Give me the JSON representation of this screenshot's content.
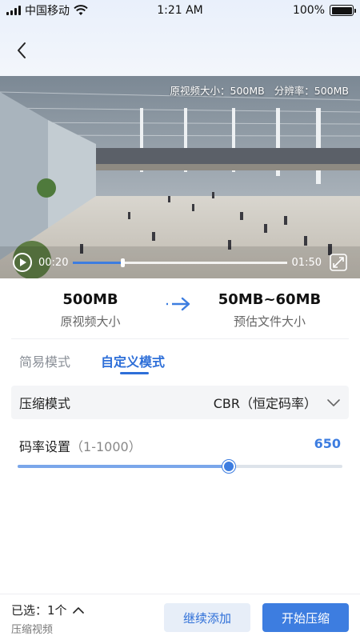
{
  "status_bar": {
    "carrier": "中国移动",
    "time": "1:21 AM",
    "battery": "100%"
  },
  "nav": {
    "back_icon": "chevron-left-icon"
  },
  "video": {
    "original_size_label": "原视频大小：500MB",
    "resolution_label": "分辨率：500MB",
    "current_time": "00:20",
    "duration": "01:50",
    "progress_fraction": 0.23
  },
  "size_compare": {
    "original_value": "500MB",
    "original_label": "原视频大小",
    "estimated_value": "50MB~60MB",
    "estimated_label": "预估文件大小"
  },
  "tabs": [
    {
      "label": "简易模式",
      "active": false
    },
    {
      "label": "自定义模式",
      "active": true
    }
  ],
  "mode": {
    "label": "压缩模式",
    "value": "CBR（恒定码率）"
  },
  "bitrate": {
    "label": "码率设置",
    "range": "（1-1000）",
    "value": "650",
    "fraction": 0.65
  },
  "bottom": {
    "selected": "已选：1个",
    "sub_label": "压缩视频",
    "continue_button": "继续添加",
    "start_button": "开始压缩"
  },
  "colors": {
    "accent": "#3d7de0",
    "tab_active": "#2e6fd8"
  }
}
